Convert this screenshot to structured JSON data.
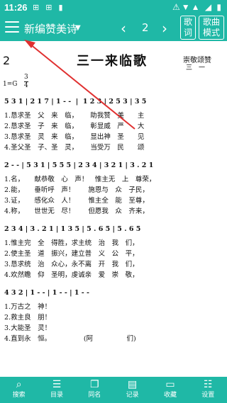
{
  "status": {
    "time": "11:26",
    "left_icons": "⊞ ⊞ ▮",
    "right_icons": "⚠▼▲ ◢ ▮"
  },
  "appbar": {
    "title": "新编赞美诗",
    "page_number": "2",
    "lyrics_button": "歌\n词",
    "mode_button": "歌曲\n模式"
  },
  "sheet": {
    "hymn_number": "2",
    "title": "三一来临歌",
    "author": "崇敬颂赞",
    "author_sub": "三　一",
    "key": "1=G",
    "time_sig_top": "3",
    "time_sig_bottom": "4",
    "systems": [
      {
        "notes": "5 3 1 | 2 1 7 | 1 - -  |  1 2 3 | 2 5 3 | 3 5",
        "lyrics": [
          "1.恳求圣　父　来　临，　　 助我赞　美　　主",
          "2.恳求圣　子　来　临，　　 彰显威　严　　大",
          "3.恳求圣　灵　来　临，　　 显出神　圣　　见",
          "4.圣父圣　子、圣　灵，　　 当受万　民　　颂"
        ]
      },
      {
        "notes": "2 - - | 5 3 1 | 5 5 5 | 2 3 4 | 3 2 1 | 3 . 2 1",
        "lyrics": [
          "1.名，　　献恭敬　心　声！　惟主无　上　尊荣，",
          "2.能，　　垂听呼　声！　　施恩与　众　子民，",
          "3.证，　　感化众　人！　　惟主全　能　至尊，",
          "4.称，　　世世无　尽！　　但愿我　众　齐来，"
        ]
      },
      {
        "notes": "2 3 4 | 3 . 2 1 | 1 3 5 | 5 . 6 5 | 5 . 6 5",
        "lyrics": [
          "1.惟主完　全　得胜，求主统　治　我　们，",
          "2.使主圣　道　振兴，建立普　义　公　平，",
          "3.恳求统　治　众心，永不离　开　我　们，",
          "4.欢然瞻　仰　圣明，虔诚亲　爱　崇　敬，"
        ]
      },
      {
        "notes": "4 3 2 | 1 - - | 1 - - | 1 - -",
        "lyrics": [
          "1.万古之　神！",
          "2.救主良　朋！",
          "3.大能圣　灵！",
          "4.直到永　恒。　　　　　 (阿　　　　　们)"
        ]
      }
    ]
  },
  "bottom_nav": [
    {
      "label": "搜索",
      "icon": "search-icon",
      "glyph": "⌕"
    },
    {
      "label": "目录",
      "icon": "list-icon",
      "glyph": "☰"
    },
    {
      "label": "同名",
      "icon": "copy-icon",
      "glyph": "❐"
    },
    {
      "label": "记录",
      "icon": "history-icon",
      "glyph": "▤"
    },
    {
      "label": "收藏",
      "icon": "bookmark-icon",
      "glyph": "▭"
    },
    {
      "label": "设置",
      "icon": "settings-icon",
      "glyph": "☷"
    }
  ],
  "colors": {
    "accent": "#1fb8a6",
    "annotation": "#e03030"
  }
}
